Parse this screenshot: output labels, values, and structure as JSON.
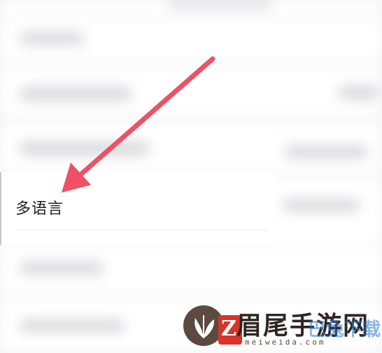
{
  "settings_item": {
    "label": "多语言"
  },
  "arrow": {
    "color": "#f05064",
    "icon": "arrow-pointer-icon"
  },
  "watermark": {
    "logo_icon": "leaf-logo-icon",
    "mark_text": "Z",
    "title": "眉尾手游网",
    "overlay_text": "巴兔下载",
    "url": "meiweida.com"
  }
}
